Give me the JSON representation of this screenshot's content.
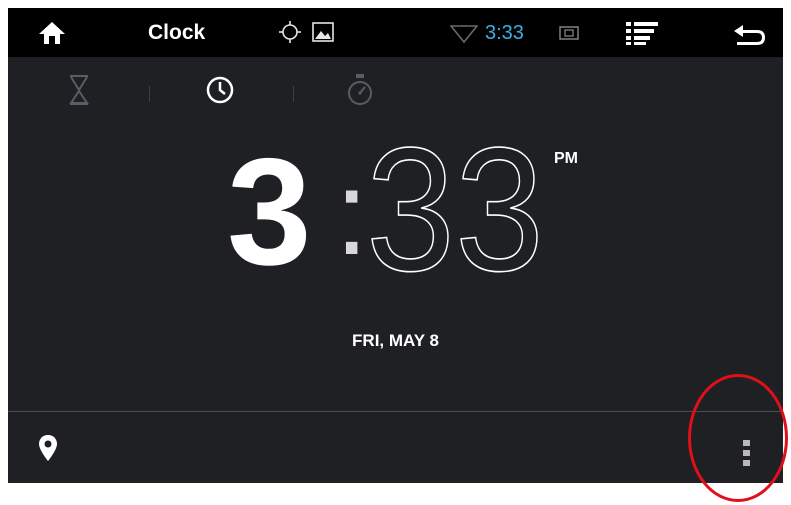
{
  "status_bar": {
    "title": "Clock",
    "time": "3:33",
    "time_color": "#3ab0e2",
    "icons": [
      "home-icon",
      "crosshair-icon",
      "gallery-icon",
      "wifi-icon",
      "sd-card-icon",
      "menu-list-icon",
      "back-icon"
    ]
  },
  "tabs": [
    {
      "name": "timer",
      "icon": "hourglass-icon",
      "selected": false
    },
    {
      "name": "clock",
      "icon": "clock-icon",
      "selected": true
    },
    {
      "name": "stopwatch",
      "icon": "stopwatch-icon",
      "selected": false
    }
  ],
  "clock": {
    "hour": "3",
    "colon": ":",
    "minutes": "33",
    "ampm": "PM",
    "date": "FRI, MAY 8"
  },
  "bottom_bar": {
    "icons": [
      "location-pin-icon",
      "overflow-menu-icon"
    ]
  },
  "annotation": {
    "color": "#e0101a",
    "target": "overflow-menu"
  }
}
